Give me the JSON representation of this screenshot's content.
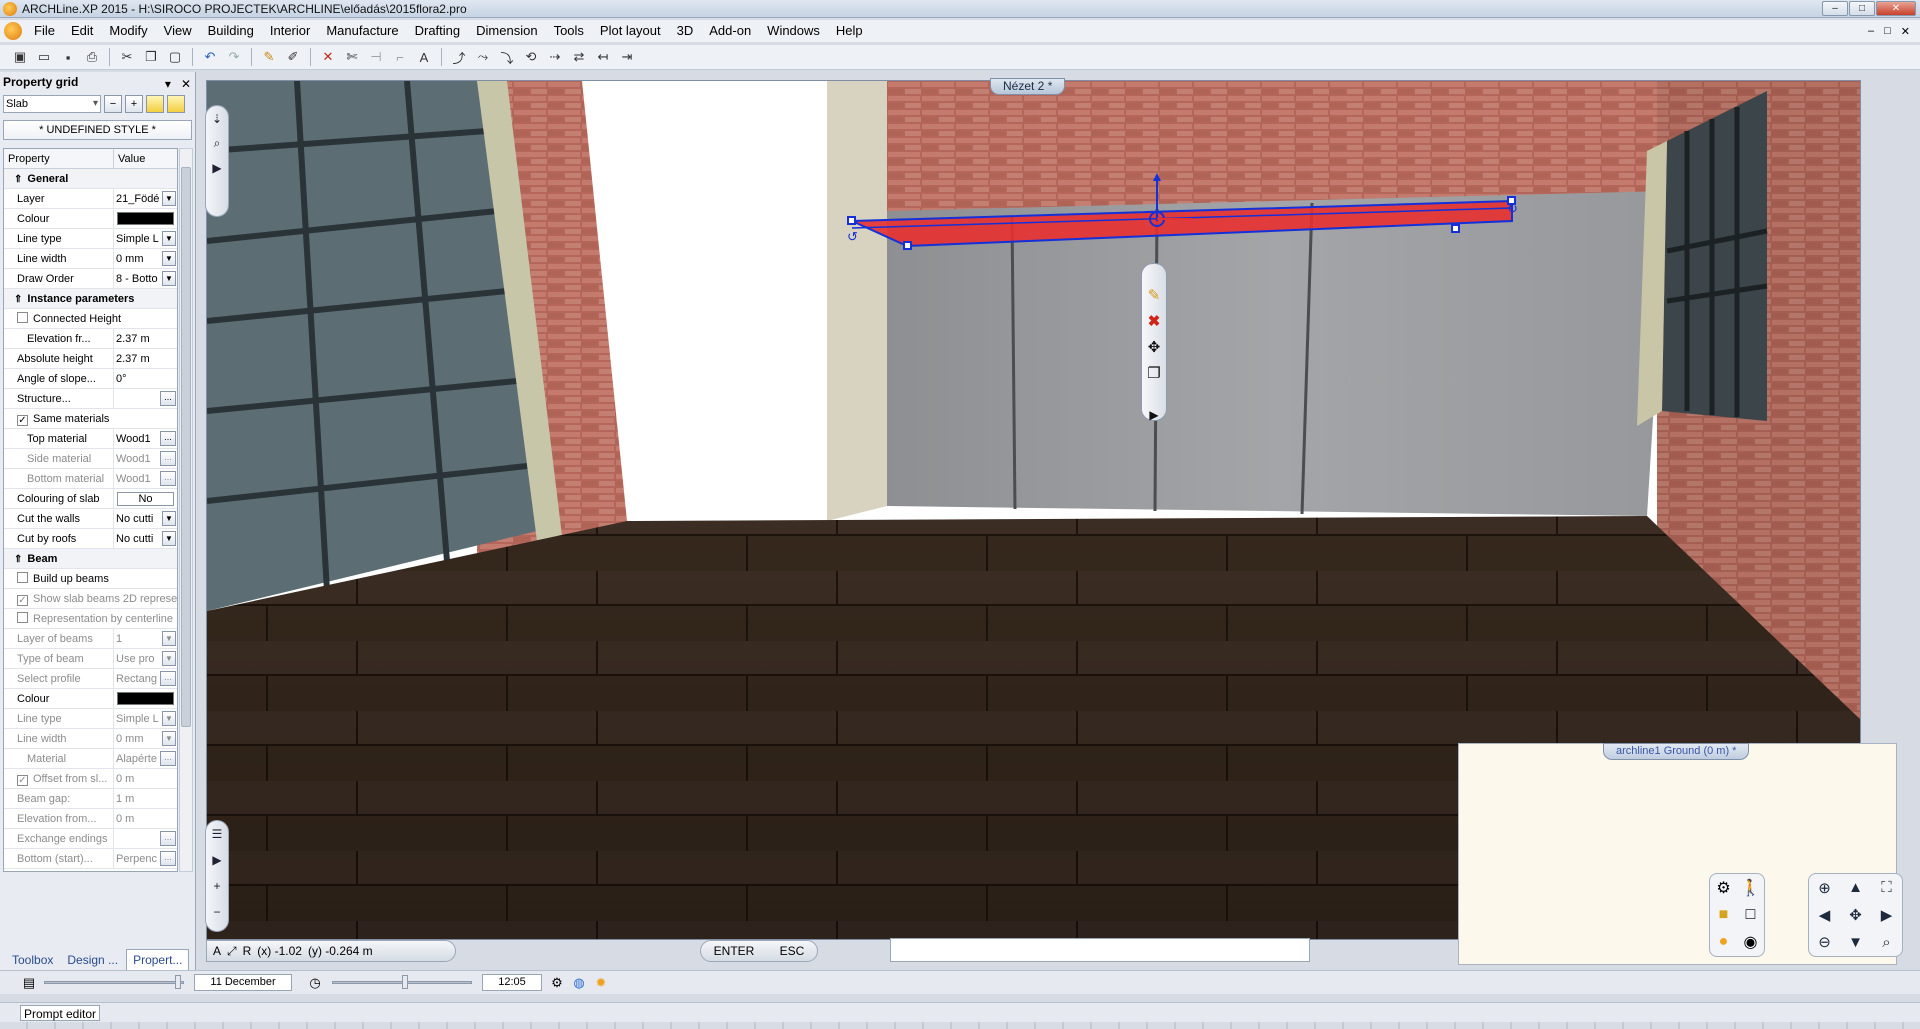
{
  "window": {
    "title": "ARCHLine.XP 2015 - H:\\SIROCO PROJECTEK\\ARCHLINE\\előadás\\2015flora2.pro",
    "buttons": [
      "–",
      "□",
      "✕"
    ]
  },
  "menu": {
    "items": [
      "File",
      "Edit",
      "Modify",
      "View",
      "Building",
      "Interior",
      "Manufacture",
      "Drafting",
      "Dimension",
      "Tools",
      "Plot layout",
      "3D",
      "Add-on",
      "Windows",
      "Help"
    ],
    "mdi_buttons": [
      "–",
      "□",
      "✕"
    ]
  },
  "toolbar": {
    "icons": [
      "new-icon",
      "open-icon",
      "save-icon",
      "print-icon",
      "cut-icon",
      "copy-icon",
      "paste-icon",
      "undo-icon",
      "redo-icon",
      "brush-icon",
      "pen-icon",
      "delete-icon",
      "trim-icon",
      "extend-icon",
      "corner-icon",
      "text-icon",
      "draw-1-icon",
      "draw-2-icon",
      "draw-3-icon",
      "draw-4-icon",
      "draw-5-icon",
      "draw-6-icon",
      "draw-7-icon",
      "draw-8-icon"
    ]
  },
  "property_grid": {
    "title": "Property grid",
    "header_buttons": [
      "▾",
      "✕"
    ],
    "type": "Slab",
    "style": "* UNDEFINED STYLE *",
    "col_property": "Property",
    "col_value": "Value",
    "rows": [
      {
        "kind": "section",
        "label": "General"
      },
      {
        "kind": "select",
        "label": "Layer",
        "value": "21_Födé"
      },
      {
        "kind": "color",
        "label": "Colour",
        "value": ""
      },
      {
        "kind": "select",
        "label": "Line type",
        "value": "Simple L"
      },
      {
        "kind": "select",
        "label": "Line width",
        "value": "0 mm"
      },
      {
        "kind": "select",
        "label": "Draw Order",
        "value": "8 - Botto"
      },
      {
        "kind": "section",
        "label": "Instance parameters"
      },
      {
        "kind": "check",
        "label": "Connected Height",
        "checked": false
      },
      {
        "kind": "text",
        "label": "Elevation fr...",
        "value": "2.37 m",
        "indent": true
      },
      {
        "kind": "text",
        "label": "Absolute height",
        "value": "2.37 m"
      },
      {
        "kind": "text",
        "label": "Angle of slope...",
        "value": "0°"
      },
      {
        "kind": "dots",
        "label": "Structure...",
        "value": ""
      },
      {
        "kind": "check",
        "label": "Same materials",
        "checked": true
      },
      {
        "kind": "dots",
        "label": "Top material",
        "value": "Wood1",
        "indent": true
      },
      {
        "kind": "dots",
        "label": "Side material",
        "value": "Wood1",
        "indent": true,
        "disabled": true
      },
      {
        "kind": "dots",
        "label": "Bottom material",
        "value": "Wood1",
        "indent": true,
        "disabled": true
      },
      {
        "kind": "nobox",
        "label": "Colouring of slab",
        "value": "No"
      },
      {
        "kind": "select",
        "label": "Cut the walls",
        "value": "No cutti"
      },
      {
        "kind": "select",
        "label": "Cut by roofs",
        "value": "No cutti"
      },
      {
        "kind": "section",
        "label": "Beam"
      },
      {
        "kind": "check",
        "label": "Build up beams",
        "checked": false
      },
      {
        "kind": "check",
        "label": "Show slab beams 2D represe",
        "checked": true,
        "disabled": true
      },
      {
        "kind": "check",
        "label": "Representation by centerline",
        "checked": false,
        "disabled": true
      },
      {
        "kind": "select",
        "label": "Layer of beams",
        "value": "1",
        "disabled": true
      },
      {
        "kind": "select",
        "label": "Type of beam",
        "value": "Use pro",
        "disabled": true
      },
      {
        "kind": "dots",
        "label": "Select profile",
        "value": "Rectang",
        "disabled": true
      },
      {
        "kind": "color",
        "label": "Colour",
        "value": ""
      },
      {
        "kind": "select",
        "label": "Line type",
        "value": "Simple L",
        "disabled": true
      },
      {
        "kind": "select",
        "label": "Line width",
        "value": "0 mm",
        "disabled": true
      },
      {
        "kind": "dots",
        "label": "Material",
        "value": "Alapérte",
        "indent": true,
        "disabled": true
      },
      {
        "kind": "check",
        "label": "Offset from sl...",
        "checked": true,
        "disabled": true,
        "value": "0 m"
      },
      {
        "kind": "text",
        "label": "Beam gap:",
        "value": "1 m",
        "disabled": true
      },
      {
        "kind": "text",
        "label": "Elevation from...",
        "value": "0 m",
        "disabled": true
      },
      {
        "kind": "dots",
        "label": "Exchange endings",
        "value": "",
        "disabled": true
      },
      {
        "kind": "dots",
        "label": "Bottom (start)...",
        "value": "Perpenc",
        "disabled": true
      }
    ]
  },
  "panel_tabs": [
    "Toolbox",
    "Design ...",
    "Propert..."
  ],
  "viewport": {
    "tab_label": "Nézet 2 *",
    "mini_tab_label": "archline1 Ground (0 m) *",
    "coords_x": "(x) -1.02",
    "coords_y": "(y) -0.264 m",
    "enter_label": "ENTER",
    "esc_label": "ESC"
  },
  "status": {
    "date": "11 December",
    "time": "12:05"
  },
  "prompt": {
    "label": "Prompt editor"
  },
  "colors": {
    "selection": "#e83030",
    "handles": "#1530d8",
    "brick": "#a8584a",
    "floor": "#3a2a1e"
  }
}
